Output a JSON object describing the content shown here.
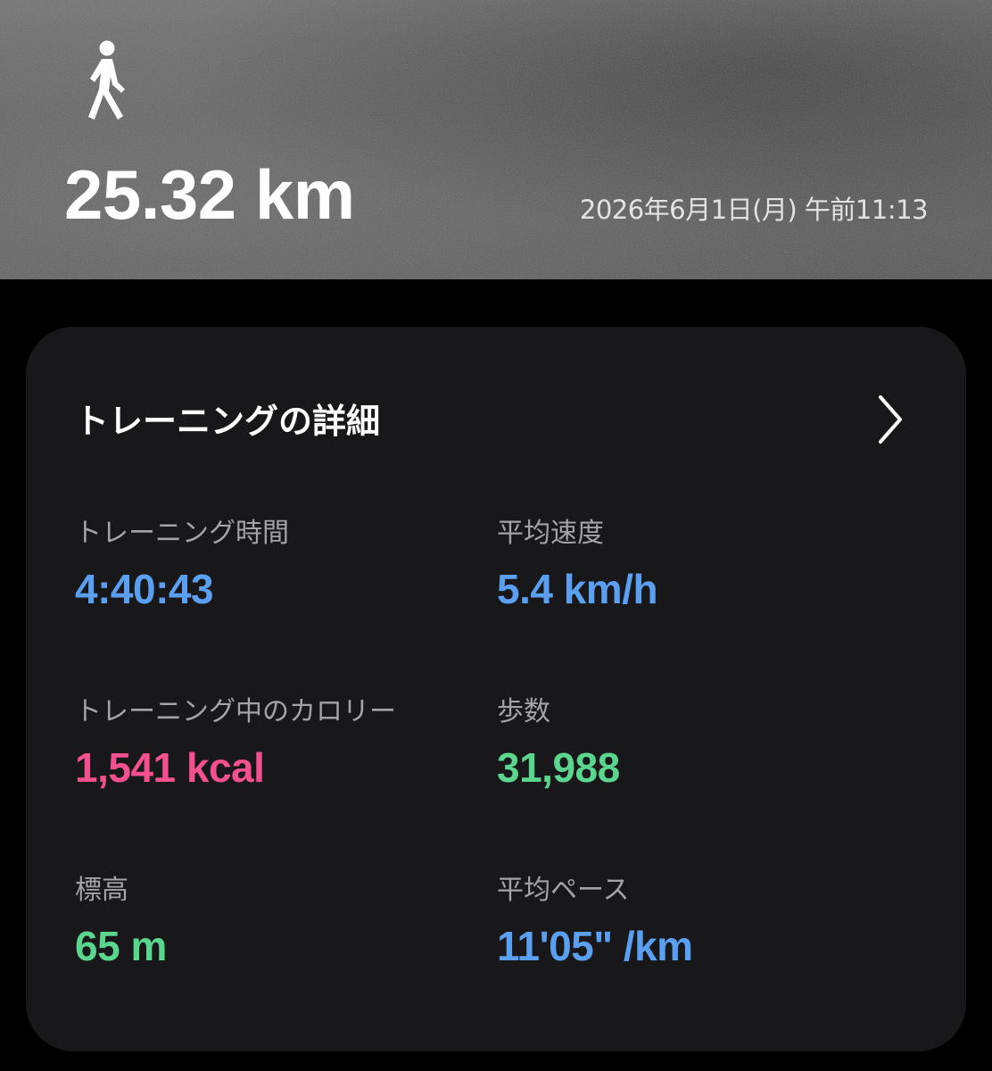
{
  "header": {
    "activity_icon": "walking-person-icon",
    "distance": "25.32 km",
    "datetime": "2026年6月1日(月) 午前11:13"
  },
  "details": {
    "title": "トレーニングの詳細",
    "chevron_icon": "chevron-right-icon",
    "stats": {
      "duration": {
        "label": "トレーニング時間",
        "value": "4:40:43"
      },
      "avg_speed": {
        "label": "平均速度",
        "value": "5.4 km/h"
      },
      "calories": {
        "label": "トレーニング中のカロリー",
        "value": "1,541 kcal"
      },
      "steps": {
        "label": "歩数",
        "value": "31,988"
      },
      "elevation": {
        "label": "標高",
        "value": "65 m"
      },
      "avg_pace": {
        "label": "平均ペース",
        "value": "11'05\" /km"
      }
    }
  },
  "colors": {
    "blue": "#5b9ff0",
    "pink": "#f2508e",
    "green": "#5bd68f",
    "card_background": "#18181a",
    "page_background": "#000000"
  }
}
